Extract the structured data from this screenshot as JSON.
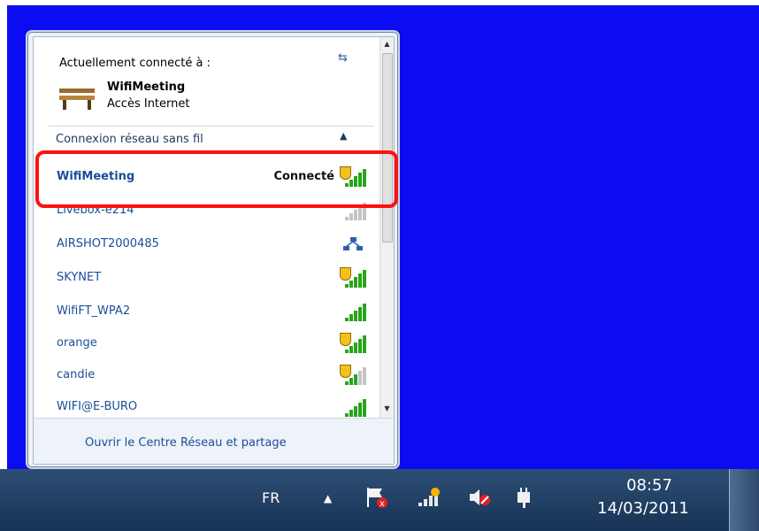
{
  "popup": {
    "currently_connected_label": "Actuellement connecté à :",
    "current_network_name": "WifiMeeting",
    "current_network_status": "Accès Internet",
    "section_label": "Connexion réseau sans fil",
    "networks": [
      {
        "name": "WifiMeeting",
        "status": "Connecté",
        "secured": true,
        "signal": "full"
      },
      {
        "name": "Livebox-e214",
        "status": "",
        "secured": false,
        "signal": "weak"
      },
      {
        "name": "AIRSHOT2000485",
        "status": "",
        "secured": false,
        "signal": "adhoc"
      },
      {
        "name": "SKYNET",
        "status": "",
        "secured": true,
        "signal": "full"
      },
      {
        "name": "WifiFT_WPA2",
        "status": "",
        "secured": false,
        "signal": "full"
      },
      {
        "name": "orange",
        "status": "",
        "secured": true,
        "signal": "full"
      },
      {
        "name": "candie",
        "status": "",
        "secured": true,
        "signal": "partial"
      },
      {
        "name": "WIFI@E-BURO",
        "status": "",
        "secured": false,
        "signal": "full"
      }
    ],
    "footer_link": "Ouvrir le Centre Réseau et partage"
  },
  "taskbar": {
    "language": "FR",
    "time": "08:57",
    "date": "14/03/2011"
  },
  "colors": {
    "desktop": "#0c0cf2",
    "link_blue": "#1c4d97",
    "highlight_red": "#ff1010",
    "signal_green": "#28a51a"
  }
}
